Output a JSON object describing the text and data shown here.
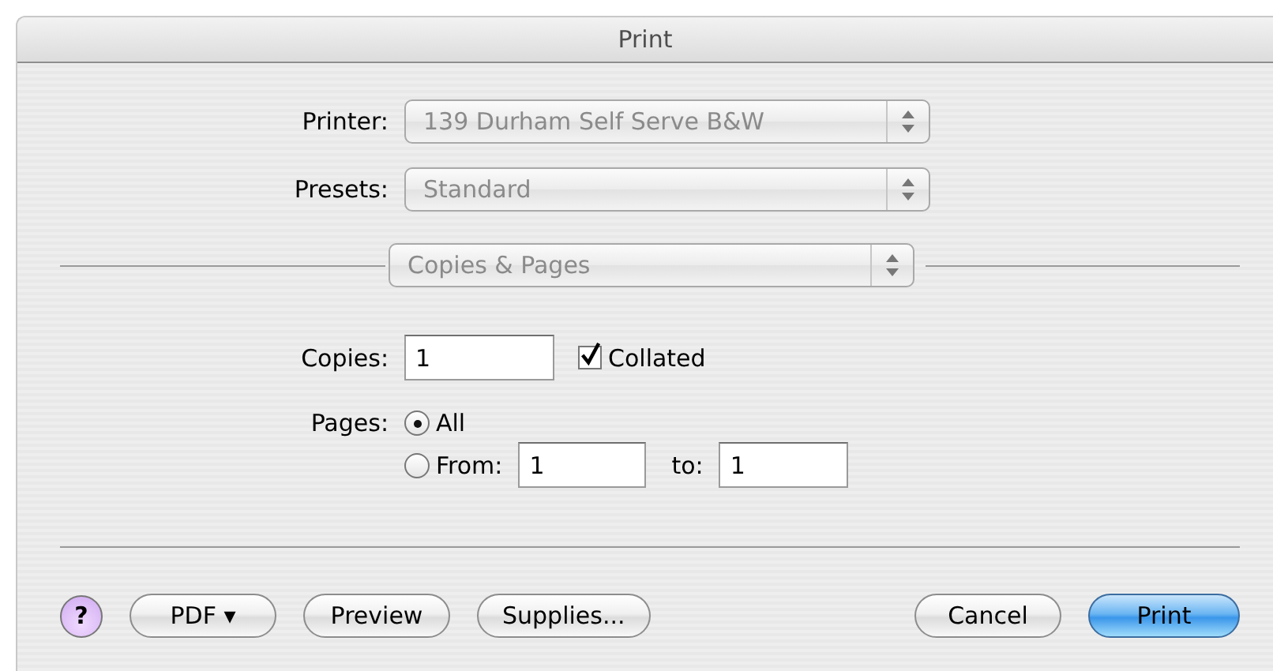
{
  "window": {
    "title": "Print"
  },
  "popups": [
    {
      "label": "Printer:",
      "value": "139 Durham Self Serve B&W",
      "disabled": true
    },
    {
      "label": "Presets:",
      "value": "Standard",
      "disabled": true
    }
  ],
  "panel_menu": {
    "value": "Copies & Pages",
    "disabled": true
  },
  "copies": {
    "label": "Copies:",
    "value": "1"
  },
  "collated": {
    "label": "Collated",
    "checked": true
  },
  "pages": {
    "label": "Pages:",
    "options": [
      {
        "label": "All",
        "selected": true
      },
      {
        "label": "From:",
        "selected": false
      }
    ],
    "from": "1",
    "to_label": "to:",
    "to": "1"
  },
  "buttons": [
    {
      "kind": "help",
      "label": "?"
    },
    {
      "kind": "normal",
      "label": "PDF ▾"
    },
    {
      "kind": "normal",
      "label": "Preview"
    },
    {
      "kind": "normal",
      "label": "Supplies..."
    },
    {
      "kind": "spacer"
    },
    {
      "kind": "normal",
      "label": "Cancel"
    },
    {
      "kind": "default",
      "label": "Print"
    }
  ]
}
